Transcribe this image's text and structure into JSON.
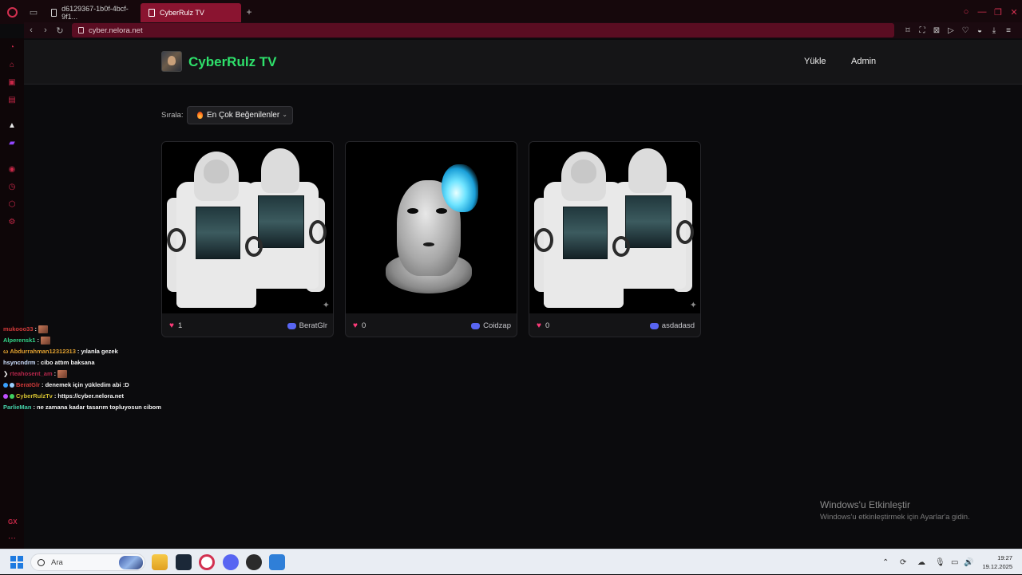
{
  "browser": {
    "tabs": [
      {
        "label": "d6129367-1b0f-4bcf-9f1..."
      },
      {
        "label": "CyberRulz TV"
      }
    ],
    "url": "cyber.nelora.net"
  },
  "site": {
    "brand": "CyberRulz TV",
    "nav": {
      "upload": "Yükle",
      "admin": "Admin"
    },
    "sort_label": "Sırala:",
    "sort_value": "En Çok Beğenilenler",
    "accent": "#2ee06b"
  },
  "cards": [
    {
      "likes": "1",
      "author": "BeratGlr",
      "image": "hoodie-pair"
    },
    {
      "likes": "0",
      "author": "Coidzap",
      "image": "knit-mask-blue-flame"
    },
    {
      "likes": "0",
      "author": "asdadasd",
      "image": "hoodie-pair"
    }
  ],
  "chat": [
    {
      "user": "mukooo33",
      "color": "#d23a3a",
      "msg": ""
    },
    {
      "user": "Alperensk1",
      "color": "#33d68a",
      "msg": ""
    },
    {
      "user": "Abdurrahman12312313",
      "color": "#e0a030",
      "msg": ": yılanla gezek"
    },
    {
      "user": "hsyncndrm",
      "color": "#cfe0ff",
      "msg": ": cibo attım baksana"
    },
    {
      "user": "rteahosent_am",
      "color": "#b3264a",
      "msg": ":"
    },
    {
      "user": "BeratGlr",
      "color": "#d23a3a",
      "msg": ": denemek için yükledim abi :D"
    },
    {
      "user": "CyberRulzTv",
      "color": "#d4c030",
      "msg": ": https://cyber.nelora.net"
    },
    {
      "user": "ParlieMan",
      "color": "#44d0a8",
      "msg": ": ne zamana kadar tasarım topluyosun cibom"
    }
  ],
  "watermark": {
    "title": "Windows'u Etkinleştir",
    "subtitle": "Windows'u etkinleştirmek için Ayarlar'a gidin."
  },
  "taskbar": {
    "search_placeholder": "Ara",
    "time": "19:27",
    "date": "19.12.2025"
  }
}
